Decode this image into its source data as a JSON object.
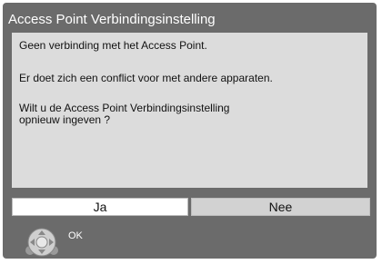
{
  "dialog": {
    "title": "Access Point Verbindingsinstelling",
    "message_line1": "Geen verbinding met het Access Point.",
    "message_line2": "Er doet zich een conflict voor met andere apparaten.",
    "message_line3": "Wilt u de Access Point Verbindingsinstelling\nopnieuw ingeven ?"
  },
  "buttons": {
    "yes_label": "Ja",
    "no_label": "Nee"
  },
  "hint": {
    "ok_label": "OK",
    "icon": "dpad-ok-icon"
  },
  "colors": {
    "dialog_bg": "#6b6b6b",
    "content_bg": "#dcdcdc",
    "selected_button_bg": "#ffffff",
    "unselected_button_bg": "#d2d2d2"
  }
}
